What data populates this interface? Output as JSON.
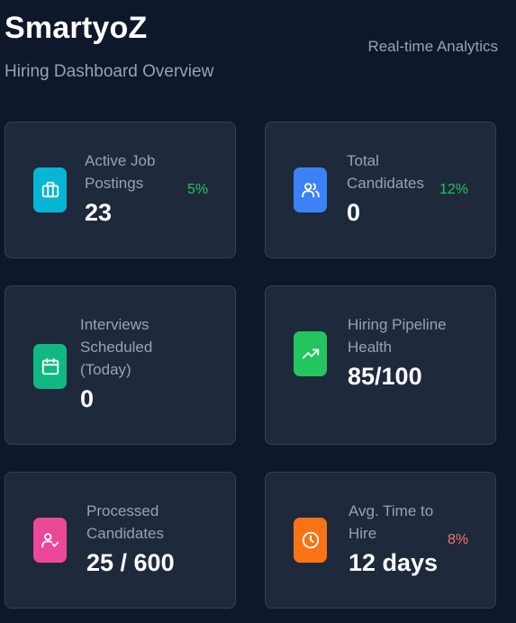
{
  "header": {
    "brand": "SmartyoZ",
    "subtitle": "Hiring Dashboard Overview",
    "tagline": "Real-time Analytics"
  },
  "cards": [
    {
      "label_lines": [
        "Active Job",
        "Postings"
      ],
      "value": "23",
      "change": "5%",
      "change_trend": "up",
      "icon": "briefcase-icon",
      "icon_color": "#06b6d4"
    },
    {
      "label_lines": [
        "Total",
        "Candidates"
      ],
      "value": "0",
      "change": "12%",
      "change_trend": "up",
      "icon": "users-icon",
      "icon_color": "#3b82f6"
    },
    {
      "label_lines": [
        "Interviews",
        "Scheduled",
        "(Today)"
      ],
      "value": "0",
      "icon": "calendar-icon",
      "icon_color": "#10b981"
    },
    {
      "label_lines": [
        "Hiring Pipeline",
        "Health"
      ],
      "value": "85/100",
      "icon": "trending-up-icon",
      "icon_color": "#22c55e"
    },
    {
      "label_lines": [
        "Processed",
        "Candidates"
      ],
      "value": "25 / 600",
      "icon": "user-check-icon",
      "icon_color": "#ec4899"
    },
    {
      "label_lines": [
        "Avg. Time to",
        "Hire"
      ],
      "value": "12 days",
      "change": "8%",
      "change_trend": "down",
      "icon": "clock-icon",
      "icon_color": "#f97316"
    }
  ],
  "colors": {
    "background": "#0f172a",
    "card": "#1e293b",
    "muted_text": "#94a3b8",
    "positive": "#22c55e",
    "negative": "#f87171"
  }
}
